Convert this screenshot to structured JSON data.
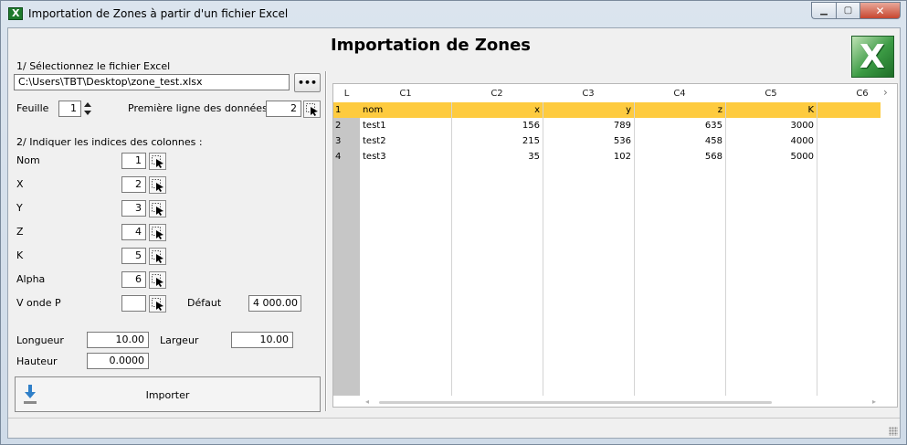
{
  "window": {
    "title": "Importation de Zones à partir d'un fichier Excel",
    "controls": {
      "minimize": "▁",
      "maximize": "▢",
      "close": "✕"
    }
  },
  "main_title": "Importation de Zones",
  "step1": {
    "label": "1/ Sélectionnez le fichier Excel",
    "file_path": "C:\\Users\\TBT\\Desktop\\zone_test.xlsx",
    "browse_label": "•••"
  },
  "sheet": {
    "label": "Feuille",
    "value": "1"
  },
  "first_row": {
    "label": "Première ligne des données",
    "value": "2"
  },
  "step2": {
    "label": "2/ Indiquer les indices des colonnes :"
  },
  "columns": [
    {
      "label": "Nom",
      "value": "1"
    },
    {
      "label": "X",
      "value": "2"
    },
    {
      "label": "Y",
      "value": "3"
    },
    {
      "label": "Z",
      "value": "4"
    },
    {
      "label": "K",
      "value": "5"
    },
    {
      "label": "Alpha",
      "value": "6"
    },
    {
      "label": "V onde P",
      "value": ""
    }
  ],
  "default": {
    "label": "Défaut",
    "value": "4 000.00"
  },
  "dims": {
    "longueur": {
      "label": "Longueur",
      "value": "10.00"
    },
    "largeur": {
      "label": "Largeur",
      "value": "10.00"
    },
    "hauteur": {
      "label": "Hauteur",
      "value": "0.0000"
    }
  },
  "import_button": {
    "label": "Importer",
    "icon": "download-arrow-icon"
  },
  "grid": {
    "corner": "L",
    "headers": [
      "C1",
      "C2",
      "C3",
      "C4",
      "C5",
      "C6"
    ],
    "row_numbers": [
      "1",
      "2",
      "3",
      "4"
    ],
    "rows": [
      [
        "nom",
        "x",
        "y",
        "z",
        "K",
        ""
      ],
      [
        "test1",
        "156",
        "789",
        "635",
        "3000",
        ""
      ],
      [
        "test2",
        "215",
        "536",
        "458",
        "4000",
        ""
      ],
      [
        "test3",
        "35",
        "102",
        "568",
        "5000",
        ""
      ]
    ],
    "header_row_color": "#fecb3f",
    "more_columns_arrow": "›"
  }
}
